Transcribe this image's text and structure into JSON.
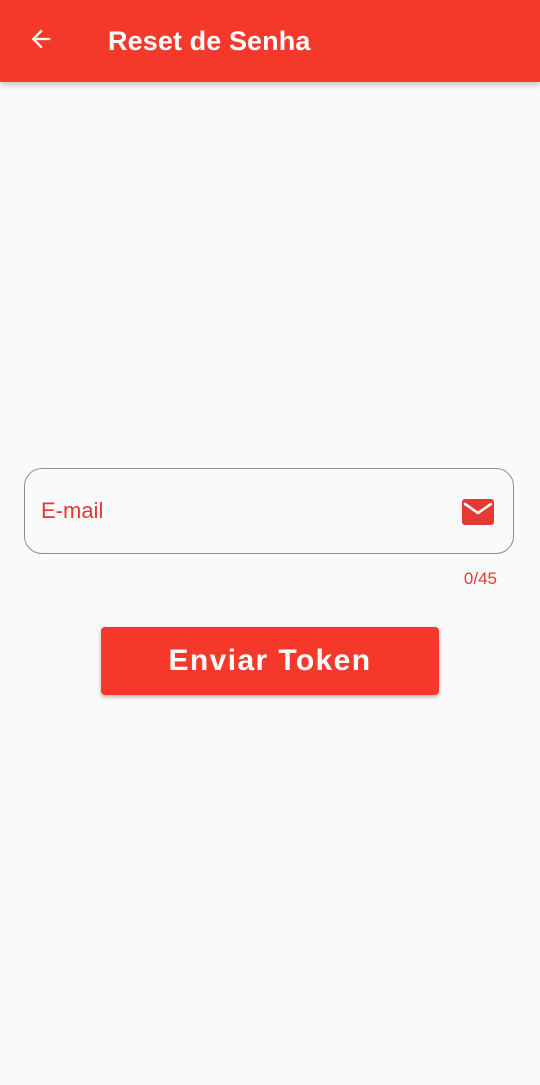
{
  "app_bar": {
    "title": "Reset de Senha",
    "back_icon": "arrow-back-icon",
    "background_color": "#f4392b"
  },
  "form": {
    "email_field": {
      "placeholder": "E-mail",
      "value": "",
      "icon": "mail-icon",
      "counter": "0/45",
      "max_length": 45
    },
    "submit_button": {
      "label": "Enviar Token"
    }
  },
  "colors": {
    "accent": "#f4392b",
    "label_red": "#e53935",
    "background": "#fafafa",
    "field_border": "#8f8f8f"
  }
}
